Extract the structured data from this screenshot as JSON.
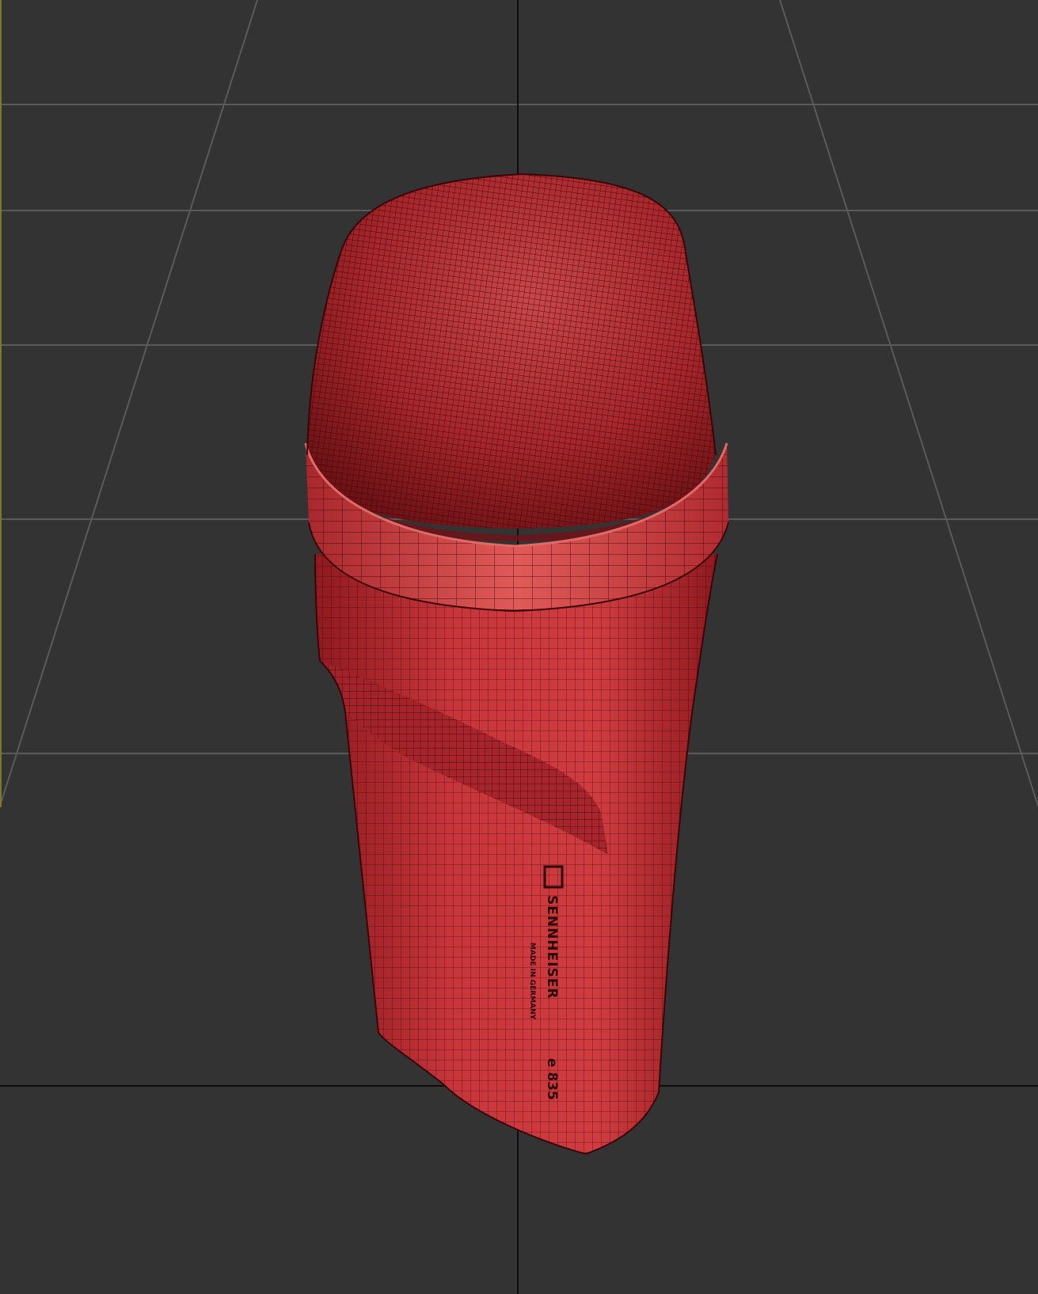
{
  "viewport": {
    "background": "#333333",
    "grid_color": "#5a5a5a",
    "axis_color": "#0d0d0d",
    "left_edge_accent": "#7a7a2a"
  },
  "model": {
    "name": "microphone",
    "body_color": "#c8363b",
    "body_shadow": "#8e1a1f",
    "wire_color": "#3a0508",
    "rim_highlight": "#e06a66"
  },
  "engravings": {
    "brand": "SENNHEISER",
    "subline": "MADE IN GERMANY",
    "model_code": "e 835"
  }
}
